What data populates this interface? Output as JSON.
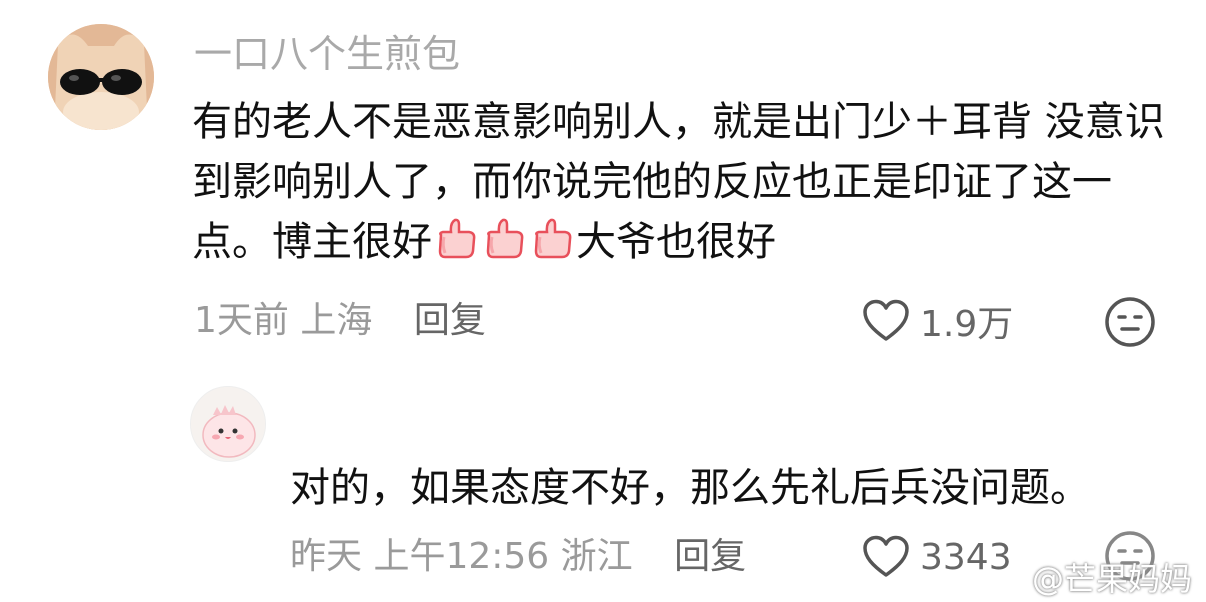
{
  "comment": {
    "username": "一口八个生煎包",
    "text_before_emoji": "有的老人不是恶意影响别人，就是出门少＋耳背 没意识到影响别人了，而你说完他的反应也正是印证了这一点。博主很好",
    "emoji": "thumbs-up-icon",
    "emoji_count": 3,
    "text_after_emoji": "大爷也很好",
    "time": "1天前",
    "location": "上海",
    "reply_label": "回复",
    "like_count": "1.9万"
  },
  "reply": {
    "text": "对的，如果态度不好，那么先礼后兵没问题。",
    "time": "昨天 上午12:56",
    "location": "浙江",
    "reply_label": "回复",
    "like_count": "3343"
  },
  "watermark": {
    "text": "@芒果妈妈"
  },
  "colors": {
    "text_primary": "#111111",
    "text_secondary": "#9a9a9a",
    "icon_gray": "#666666",
    "thumbs_pink": "#f26f7b"
  }
}
